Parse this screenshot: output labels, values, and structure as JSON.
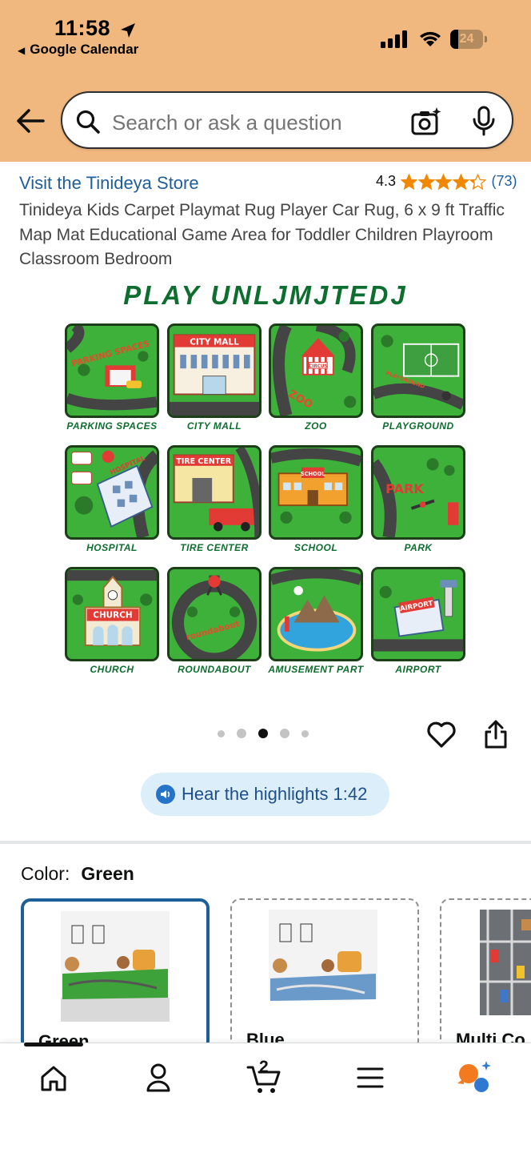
{
  "status_bar": {
    "time": "11:58",
    "back_app": "Google Calendar",
    "battery_percent": "24",
    "battery_level": 0.24
  },
  "search": {
    "placeholder": "Search or ask a question",
    "icons": [
      "back-arrow-icon",
      "search-icon",
      "camera-icon",
      "microphone-icon"
    ]
  },
  "product": {
    "store_link": "Visit the Tinideya Store",
    "rating": "4.3",
    "rating_stars": 4.3,
    "review_count": "(73)",
    "title": "Tinideya Kids Carpet Playmat Rug Player Car Rug, 6 x 9 ft Traffic Map Mat Educational Game Area for Toddler Children Playroom Classroom Bedroom"
  },
  "image": {
    "headline": "PLAY UNLJMJTEDJ",
    "tiles": [
      "PARKING SPACES",
      "CITY MALL",
      "ZOO",
      "PLAYGROUND",
      "HOSPITAL",
      "TIRE CENTER",
      "SCHOOL",
      "PARK",
      "CHURCH",
      "ROUNDABOUT",
      "AMUSEMENT PART",
      "AIRPORT"
    ],
    "tile_labels": {
      "parking": "PARKING SPACES",
      "mall": "CITY MALL",
      "circus": "CIRCUS",
      "zoo": "ZOO",
      "playground": "PLAYGROUND",
      "hospital": "HOSPITAL",
      "tire": "TIRE CENTER",
      "school": "SCHOOL",
      "park": "PARK",
      "church": "CHURCH",
      "roundabout": "roundabout",
      "airport": "AIRPORT"
    }
  },
  "carousel": {
    "dot_count": 5,
    "active_index": 2
  },
  "audio": {
    "label": "Hear the highlights 1:42"
  },
  "color": {
    "label": "Color:",
    "selected": "Green",
    "options": [
      "Green",
      "Blue",
      "Multi Co"
    ]
  },
  "bottom_nav": {
    "items": [
      "home-icon",
      "account-icon",
      "cart-icon",
      "menu-icon",
      "rufus-ai-icon"
    ],
    "cart_count": "2"
  },
  "colors": {
    "header_bg": "#f0b87f",
    "link": "#1f5d9b",
    "star": "#f08804",
    "headline_green": "#0d6e2f",
    "tile_green": "#3eb13a",
    "selected_border": "#1d5f99",
    "pill_bg": "#dbeefa"
  }
}
